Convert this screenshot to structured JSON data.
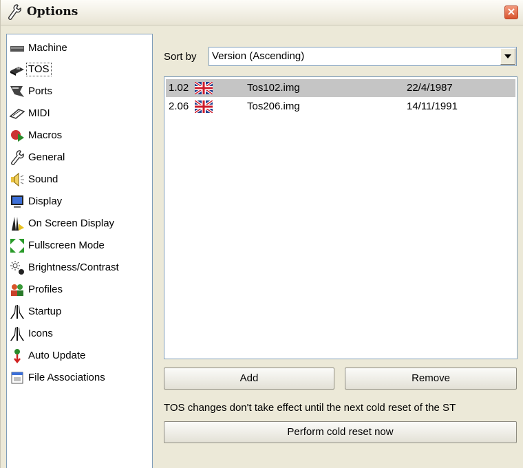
{
  "window": {
    "title": "Options",
    "close_label": "×"
  },
  "sidebar": {
    "items": [
      {
        "label": "Machine",
        "icon": "machine-icon"
      },
      {
        "label": "TOS",
        "icon": "tos-chip-icon",
        "selected": true
      },
      {
        "label": "Ports",
        "icon": "ports-icon"
      },
      {
        "label": "MIDI",
        "icon": "midi-icon"
      },
      {
        "label": "Macros",
        "icon": "macros-icon"
      },
      {
        "label": "General",
        "icon": "wrench-icon"
      },
      {
        "label": "Sound",
        "icon": "speaker-icon"
      },
      {
        "label": "Display",
        "icon": "monitor-icon"
      },
      {
        "label": "On Screen Display",
        "icon": "osd-icon"
      },
      {
        "label": "Fullscreen Mode",
        "icon": "fullscreen-icon"
      },
      {
        "label": "Brightness/Contrast",
        "icon": "brightness-icon"
      },
      {
        "label": "Profiles",
        "icon": "profiles-icon"
      },
      {
        "label": "Startup",
        "icon": "atari-logo-icon"
      },
      {
        "label": "Icons",
        "icon": "atari-logo-icon"
      },
      {
        "label": "Auto Update",
        "icon": "auto-update-icon"
      },
      {
        "label": "File Associations",
        "icon": "file-associations-icon"
      }
    ]
  },
  "sort": {
    "label": "Sort by",
    "value": "Version (Ascending)"
  },
  "tos_list": {
    "rows": [
      {
        "version": "1.02",
        "flag": "uk-flag-icon",
        "file": "Tos102.img",
        "date": "22/4/1987",
        "selected": true
      },
      {
        "version": "2.06",
        "flag": "uk-flag-icon",
        "file": "Tos206.img",
        "date": "14/11/1991",
        "selected": false
      }
    ]
  },
  "buttons": {
    "add": "Add",
    "remove": "Remove",
    "reset": "Perform cold reset now"
  },
  "notice": "TOS changes don't take effect until the next cold reset of the ST",
  "colors": {
    "selection": "#c5c5c5",
    "border": "#7f9db9",
    "panel_bg": "#ece9d8",
    "close": "#d8542f"
  }
}
